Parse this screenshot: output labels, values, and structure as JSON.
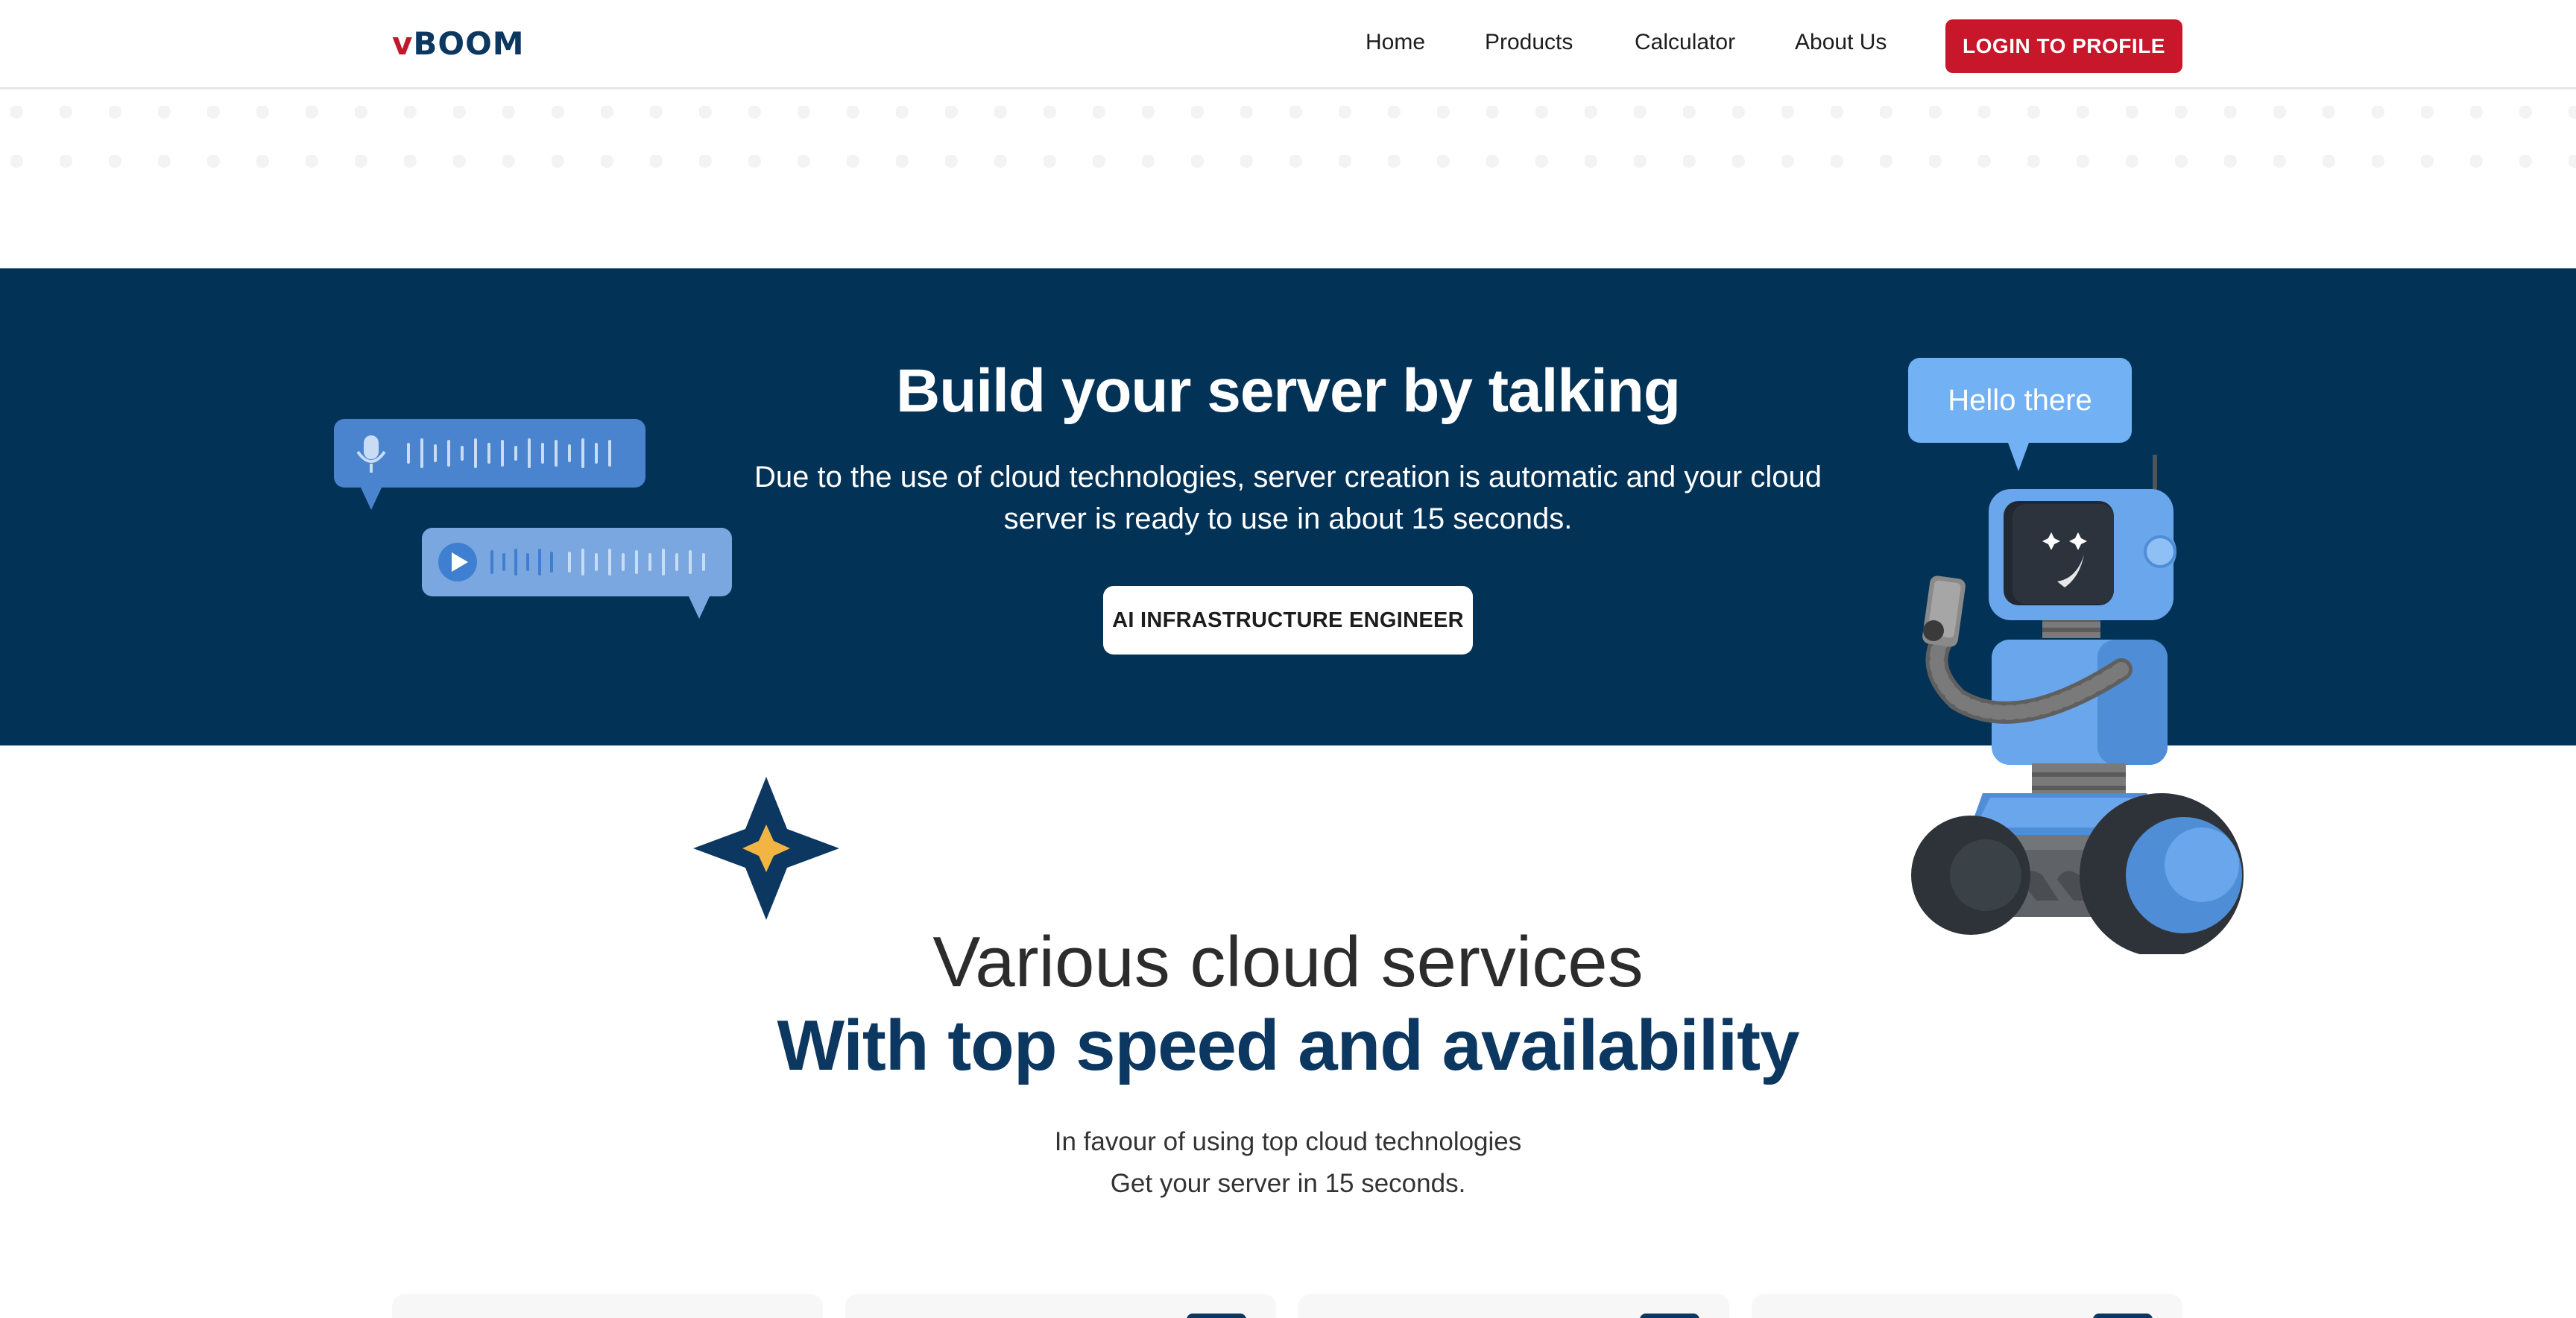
{
  "nav": {
    "logo_v": "v",
    "logo_rest": "BOOM",
    "links": [
      "Home",
      "Products",
      "Calculator",
      "About Us"
    ],
    "login_label": "LOGIN TO PROFILE"
  },
  "hero": {
    "title": "Build your server by talking",
    "description": "Due to the use of cloud technologies, server creation is automatic and your cloud server is ready to use in about 15 seconds.",
    "button_label": "AI INFRASTRUCTURE ENGINEER",
    "robot_bubble": "Hello there"
  },
  "services": {
    "title_line1": "Various cloud services",
    "title_line2": "With top speed and availability",
    "subtitle_line1": "In favour of using top cloud technologies",
    "subtitle_line2": "Get your server in 15 seconds."
  },
  "colors": {
    "brand_navy": "#033257",
    "brand_red": "#c8172a",
    "robot_blue": "#71b1f4"
  },
  "icons": [
    "microphone-icon",
    "play-icon",
    "star-icon",
    "robot-illustration"
  ]
}
